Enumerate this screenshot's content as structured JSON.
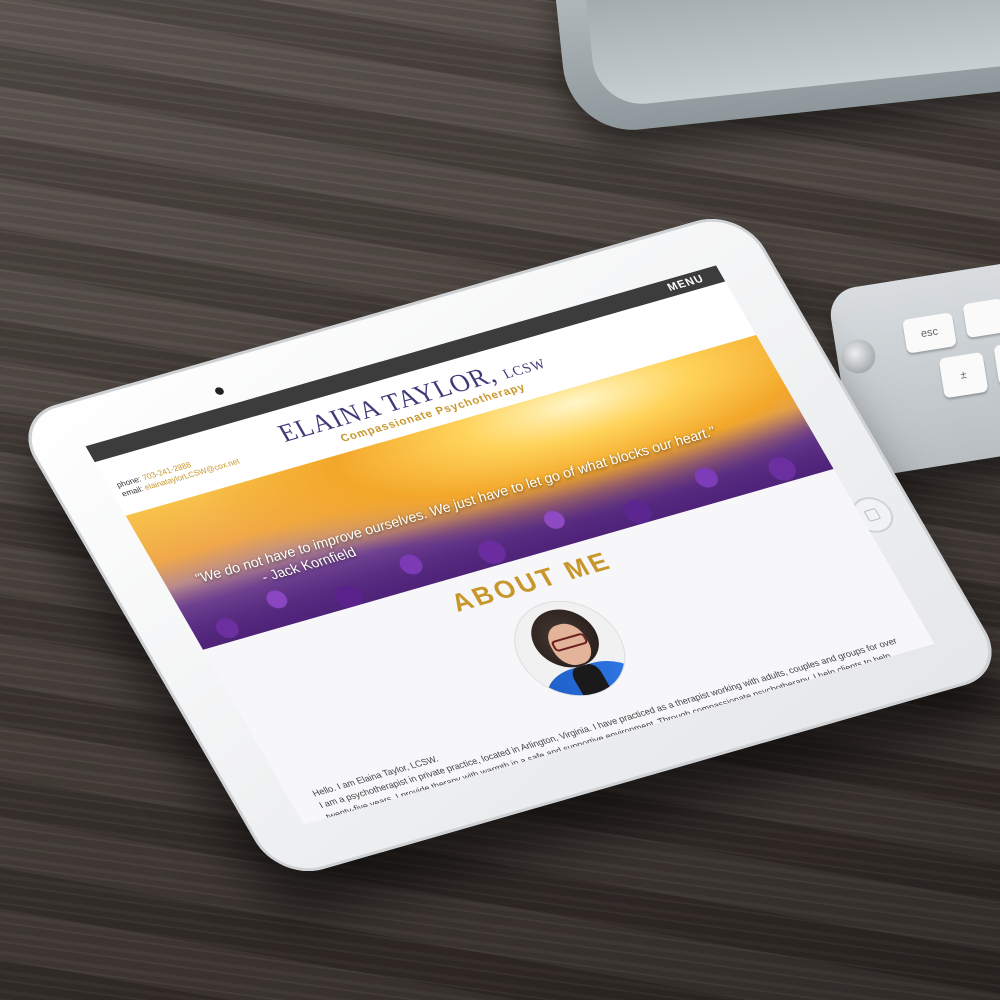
{
  "site": {
    "menu_label": "MENU",
    "name": "ELAINA TAYLOR,",
    "credential": "LCSW",
    "tagline": "Compassionate Psychotherapy",
    "phone_label": "phone:",
    "phone": "703-241-2888",
    "email_label": "email:",
    "email": "elainataylorLCSW@cox.net"
  },
  "hero": {
    "quote": "\"We do not have to improve ourselves. We just have to let go of what blocks our heart.\"",
    "author": "- Jack Kornfield"
  },
  "about": {
    "heading": "ABOUT ME",
    "greeting": "Hello. I am Elaina Taylor, LCSW.",
    "body": "I am a psychotherapist in private practice, located in Arlington, Virginia. I have practiced as a therapist working with adults, couples and groups for over twenty-five years. I provide therapy with warmth in a safe and supportive environment. Through compassionate psychotherapy, I help clients to help them heal by developing a more peaceful relationship with their feelings."
  },
  "keyboard": {
    "esc_label": "esc",
    "key2_label": "±"
  }
}
